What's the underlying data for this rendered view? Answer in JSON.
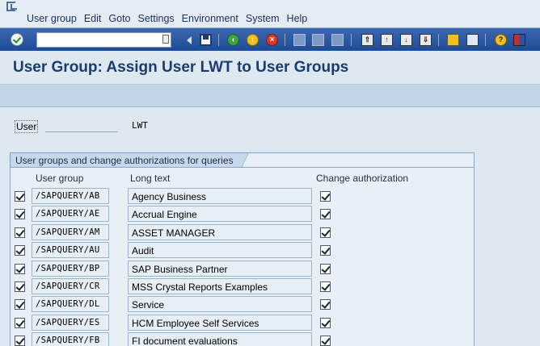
{
  "menu": {
    "items": [
      "User group",
      "Edit",
      "Goto",
      "Settings",
      "Environment",
      "System",
      "Help"
    ]
  },
  "toolbar": {
    "command_value": "",
    "icons": [
      "enter-icon",
      "save-icon",
      "back-icon",
      "exit-icon",
      "cancel-icon",
      "print-icon",
      "find-icon",
      "find-next-icon",
      "first-page-icon",
      "previous-page-icon",
      "next-page-icon",
      "last-page-icon",
      "create-session-icon",
      "shortcut-icon",
      "help-icon",
      "layout-icon"
    ]
  },
  "title": "User Group: Assign User LWT to User Groups",
  "user": {
    "label": "User",
    "value": "LWT"
  },
  "group_box": {
    "title": "User groups and change authorizations for queries",
    "headers": {
      "user_group": "User group",
      "long_text": "Long text",
      "change_auth": "Change authorization"
    },
    "rows": [
      {
        "group": "/SAPQUERY/AB",
        "text": "Agency Business",
        "assigned": true,
        "change": true
      },
      {
        "group": "/SAPQUERY/AE",
        "text": "Accrual Engine",
        "assigned": true,
        "change": true
      },
      {
        "group": "/SAPQUERY/AM",
        "text": "ASSET MANAGER",
        "assigned": true,
        "change": true
      },
      {
        "group": "/SAPQUERY/AU",
        "text": "Audit",
        "assigned": true,
        "change": true
      },
      {
        "group": "/SAPQUERY/BP",
        "text": "SAP Business Partner",
        "assigned": true,
        "change": true
      },
      {
        "group": "/SAPQUERY/CR",
        "text": "MSS Crystal Reports Examples",
        "assigned": true,
        "change": true
      },
      {
        "group": "/SAPQUERY/DL",
        "text": "Service",
        "assigned": true,
        "change": true
      },
      {
        "group": "/SAPQUERY/ES",
        "text": "HCM Employee Self Services",
        "assigned": true,
        "change": true
      },
      {
        "group": "/SAPQUERY/FB",
        "text": "FI document evaluations",
        "assigned": true,
        "change": true
      }
    ]
  }
}
